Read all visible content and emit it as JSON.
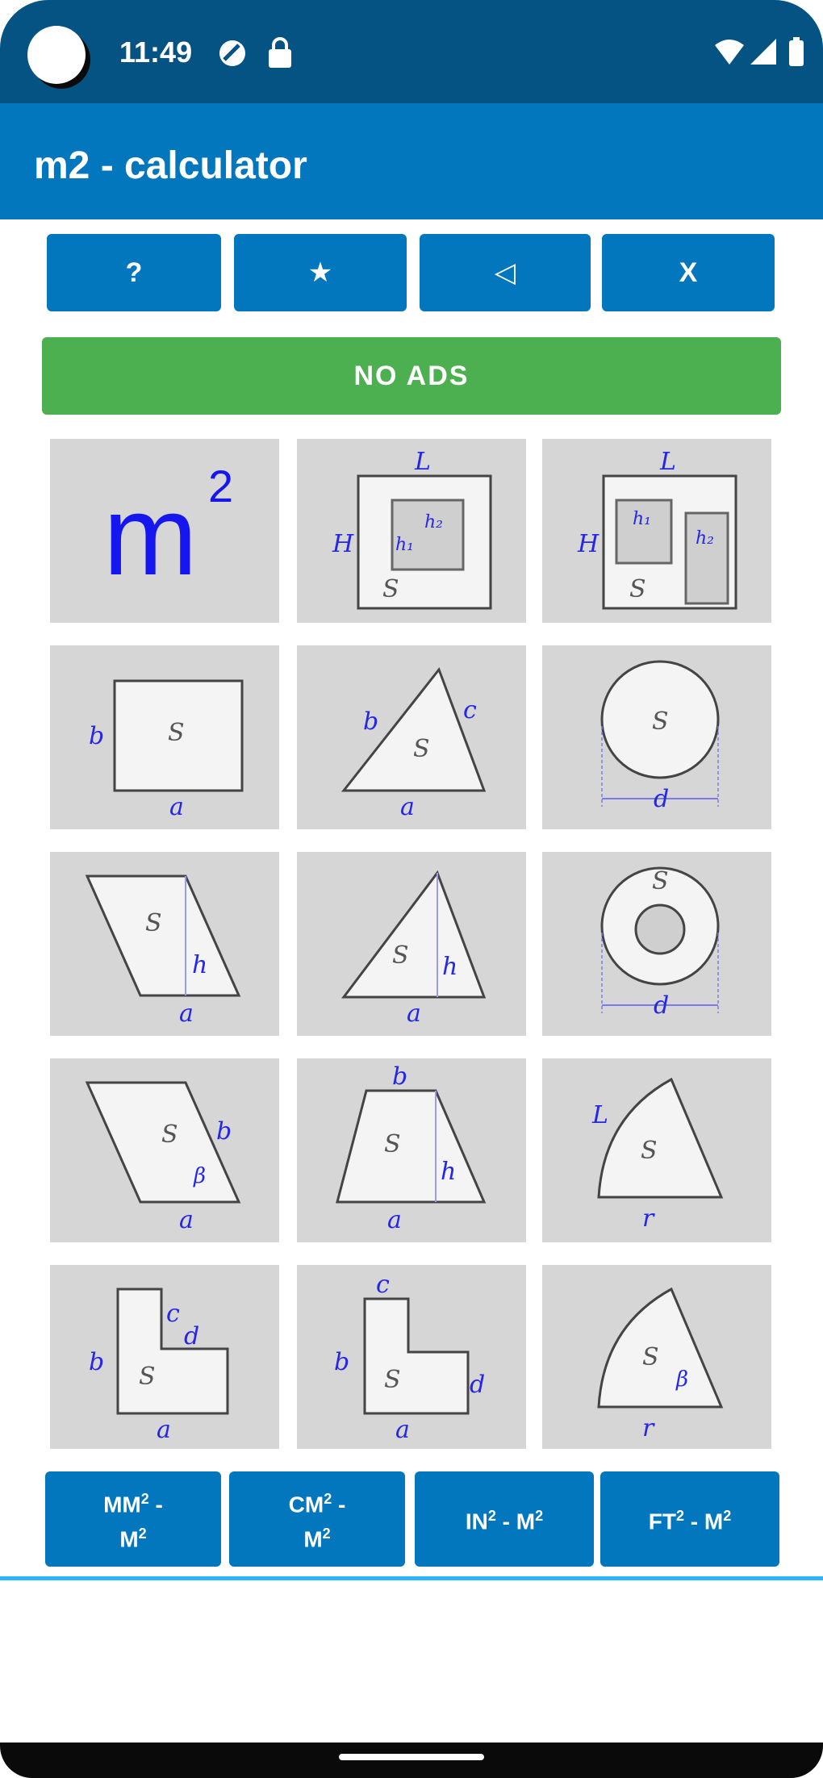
{
  "status_bar": {
    "time": "11:49"
  },
  "app_bar": {
    "title": "m2 - calculator"
  },
  "toolbar": {
    "help_label": "?",
    "rate_label": "★",
    "share_label": "◁",
    "close_label": "X"
  },
  "no_ads_label": "NO ADS",
  "tiles": {
    "m2": {
      "base": "m",
      "exp": "2"
    }
  },
  "shape_labels": {
    "L": "L",
    "H": "H",
    "h1": "h₁",
    "h2": "h₂",
    "S": "S",
    "a": "a",
    "b": "b",
    "c": "c",
    "d": "d",
    "h": "h",
    "r": "r",
    "beta": "β"
  },
  "converters": [
    {
      "line1": "MM",
      "sup": "2",
      "line2": " -",
      "line3": "M",
      "sup2": "2"
    },
    {
      "line1": "CM",
      "sup": "2",
      "line2": " -",
      "line3": "M",
      "sup2": "2"
    },
    {
      "line1": "IN",
      "sup": "2",
      "line2": " - ",
      "line3": "M",
      "sup2": "2"
    },
    {
      "line1": "FT",
      "sup": "2",
      "line2": " - ",
      "line3": "M",
      "sup2": "2"
    }
  ],
  "colors": {
    "primary": "#0277bd",
    "status": "#045383",
    "green": "#4caf50",
    "tile": "#d6d6d6",
    "label_blue": "#2626e6"
  }
}
